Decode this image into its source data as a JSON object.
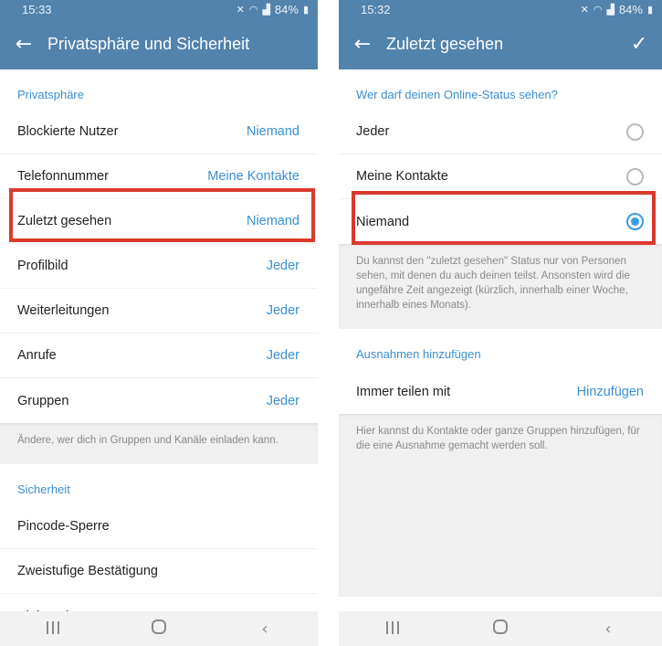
{
  "left": {
    "status": {
      "time": "15:33",
      "battery": "84%"
    },
    "appbar": {
      "title": "Privatsphäre und Sicherheit"
    },
    "privacy_header": "Privatsphäre",
    "privacy_items": [
      {
        "label": "Blockierte Nutzer",
        "value": "Niemand"
      },
      {
        "label": "Telefonnummer",
        "value": "Meine Kontakte"
      },
      {
        "label": "Zuletzt gesehen",
        "value": "Niemand"
      },
      {
        "label": "Profilbild",
        "value": "Jeder"
      },
      {
        "label": "Weiterleitungen",
        "value": "Jeder"
      },
      {
        "label": "Anrufe",
        "value": "Jeder"
      },
      {
        "label": "Gruppen",
        "value": "Jeder"
      }
    ],
    "groups_info": "Ändere, wer dich in Gruppen und Kanäle einladen kann.",
    "security_header": "Sicherheit",
    "security_items": [
      {
        "label": "Pincode-Sperre"
      },
      {
        "label": "Zweistufige Bestätigung"
      },
      {
        "label": "Aktive Sitzungen"
      }
    ]
  },
  "right": {
    "status": {
      "time": "15:32",
      "battery": "84%"
    },
    "appbar": {
      "title": "Zuletzt gesehen"
    },
    "question_header": "Wer darf deinen Online-Status sehen?",
    "options": [
      {
        "label": "Jeder",
        "selected": false
      },
      {
        "label": "Meine Kontakte",
        "selected": false
      },
      {
        "label": "Niemand",
        "selected": true
      }
    ],
    "options_info": "Du kannst den \"zuletzt gesehen\" Status nur von Personen sehen, mit denen du auch deinen teilst. Ansonsten wird die ungefähre Zeit angezeigt (kürzlich, innerhalb einer Woche, innerhalb eines Monats).",
    "exceptions_header": "Ausnahmen hinzufügen",
    "share_row": {
      "label": "Immer teilen mit",
      "action": "Hinzufügen"
    },
    "exceptions_info": "Hier kannst du Kontakte oder ganze Gruppen hinzufügen, für die eine Ausnahme gemacht werden soll."
  },
  "colors": {
    "header_bg": "#5183ad",
    "accent": "#3a8fcf",
    "highlight": "#d93a2c"
  },
  "icons": [
    "back-arrow-icon",
    "check-icon",
    "mute-icon",
    "wifi-icon",
    "signal-icon",
    "battery-icon",
    "recent-apps-icon",
    "home-icon",
    "back-nav-icon"
  ]
}
